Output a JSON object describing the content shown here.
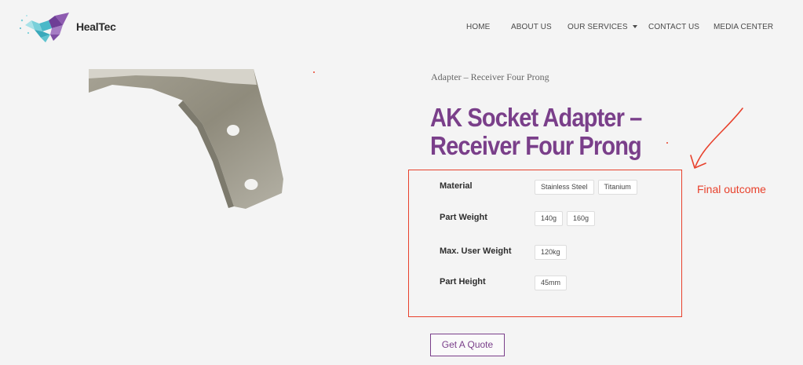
{
  "header": {
    "brand": "HealTec",
    "nav": [
      {
        "label": "HOME"
      },
      {
        "label": "ABOUT US"
      },
      {
        "label": "OUR SERVICES",
        "has_dropdown": true
      },
      {
        "label": "CONTACT US"
      },
      {
        "label": "MEDIA CENTER"
      }
    ]
  },
  "product": {
    "breadcrumb": "Adapter – Receiver Four Prong",
    "title": "AK Socket Adapter – Receiver Four Prong",
    "attributes": [
      {
        "label": "Material",
        "options": [
          "Stainless Steel",
          "Titanium"
        ]
      },
      {
        "label": "Part Weight",
        "options": [
          "140g",
          "160g"
        ]
      },
      {
        "label": "Max. User Weight",
        "options": [
          "120kg"
        ]
      },
      {
        "label": "Part Height",
        "options": [
          "45mm"
        ]
      }
    ],
    "cta": "Get A Quote"
  },
  "annotation": {
    "text": "Final outcome",
    "color": "#e8412c"
  },
  "colors": {
    "accent": "#7a3f8a",
    "annotation_red": "#e8412c",
    "background": "#f4f4f4"
  }
}
